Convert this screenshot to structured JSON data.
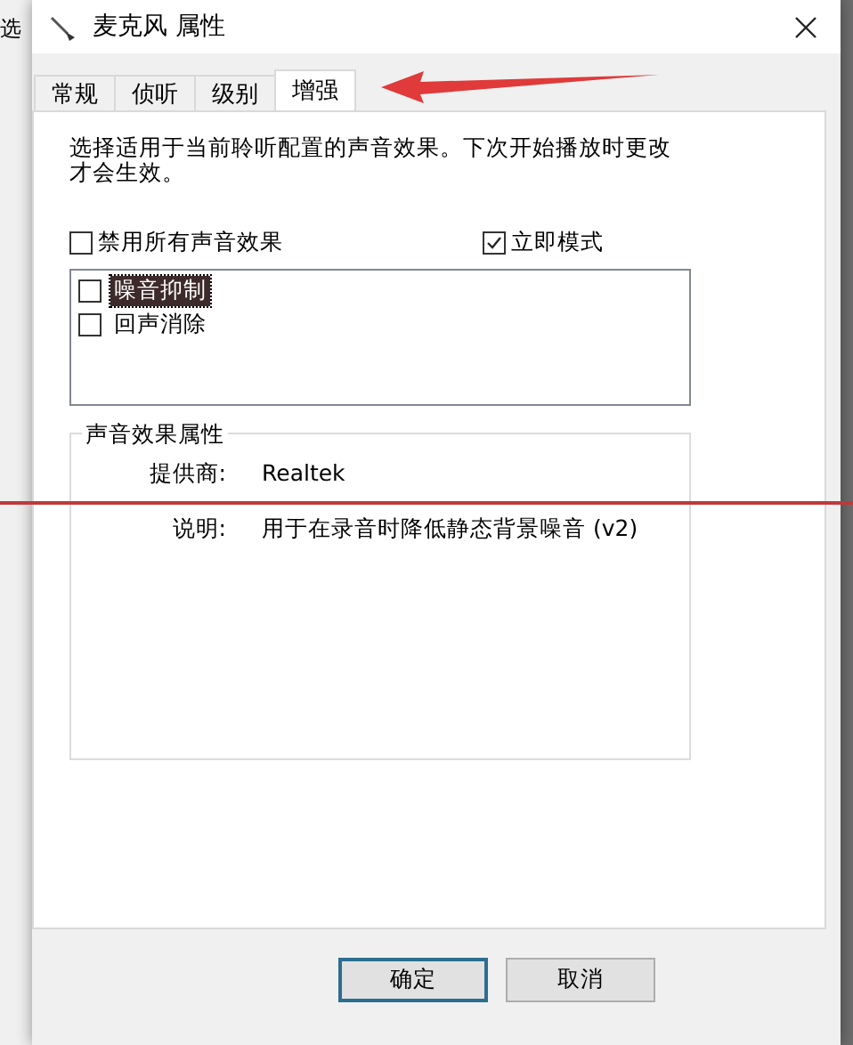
{
  "background_window": {
    "text": "选"
  },
  "window": {
    "title": "麦克风 属性"
  },
  "tabs": [
    {
      "label": "常规",
      "selected": false
    },
    {
      "label": "侦听",
      "selected": false
    },
    {
      "label": "级别",
      "selected": false
    },
    {
      "label": "增强",
      "selected": true
    }
  ],
  "description": "选择适用于当前聆听配置的声音效果。下次开始播放时更改才会生效。",
  "options": [
    {
      "label": "禁用所有声音效果",
      "checked": false
    },
    {
      "label": "立即模式",
      "checked": true
    }
  ],
  "effects": [
    {
      "label": "噪音抑制",
      "checked": false,
      "selected": true
    },
    {
      "label": "回声消除",
      "checked": false,
      "selected": false
    }
  ],
  "properties": {
    "title": "声音效果属性",
    "rows": [
      {
        "label": "提供商:",
        "value": "Realtek"
      },
      {
        "label": "说明:",
        "value": "用于在录音时降低静态背景噪音 (v2)"
      }
    ]
  },
  "buttons": [
    {
      "label": "确定",
      "default": true
    },
    {
      "label": "取消",
      "default": false
    }
  ]
}
